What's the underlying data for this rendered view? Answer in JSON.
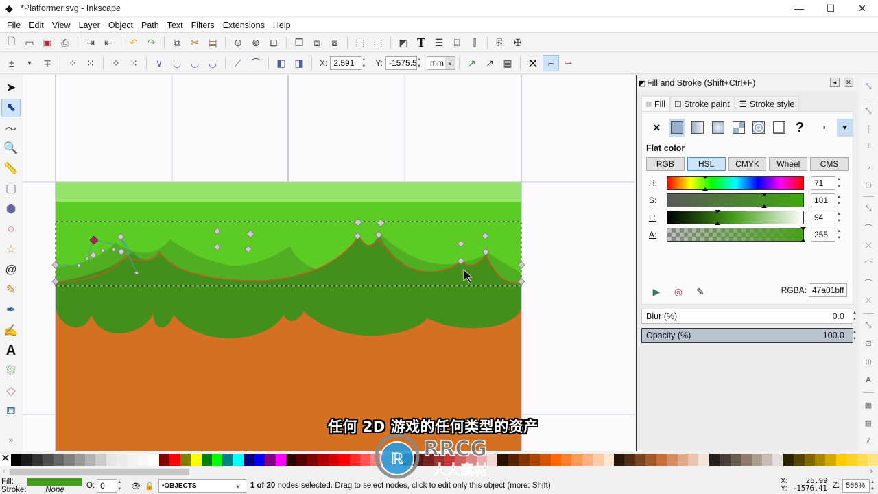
{
  "window": {
    "title": "*Platformer.svg - Inkscape",
    "controls": [
      "minimize",
      "maximize",
      "close"
    ]
  },
  "menu": [
    "File",
    "Edit",
    "View",
    "Layer",
    "Object",
    "Path",
    "Text",
    "Filters",
    "Extensions",
    "Help"
  ],
  "commands_bar": {
    "icons": [
      "new-document-icon",
      "open-icon",
      "save-icon",
      "print-icon",
      "import-icon",
      "export-icon",
      "undo-icon",
      "redo-icon",
      "copy-icon",
      "cut-icon",
      "paste-icon",
      "zoom-selection-icon",
      "zoom-drawing-icon",
      "zoom-page-icon",
      "duplicate-icon",
      "clone-icon",
      "unlink-clone-icon",
      "group-icon",
      "ungroup-icon",
      "fill-stroke-icon",
      "text-font-icon",
      "layers-icon",
      "xml-editor-icon",
      "align-icon",
      "document-properties-icon",
      "preferences-icon"
    ]
  },
  "node_toolbar": {
    "x_label": "X:",
    "x_value": "2.591",
    "y_label": "Y:",
    "y_value": "-1575.5",
    "unit": "mm"
  },
  "tools": [
    "selector",
    "node",
    "tweak",
    "zoom",
    "measure",
    "rectangle",
    "3d-box",
    "ellipse",
    "star",
    "spiral",
    "pencil",
    "pen",
    "calligraphy",
    "text",
    "spray",
    "eraser",
    "paint-bucket"
  ],
  "active_tool": "node",
  "canvas": {
    "colors": {
      "sky_light": "#96e36c",
      "grass_top": "#5ccb24",
      "grass_mid": "#4fae22",
      "grass_dark": "#438f1c",
      "dirt": "#d47021"
    }
  },
  "fill_stroke": {
    "title": "Fill and Stroke (Shift+Ctrl+F)",
    "tabs": [
      "Fill",
      "Stroke paint",
      "Stroke style"
    ],
    "active_tab": "Fill",
    "paint_type": "Flat color",
    "color_modes": [
      "RGB",
      "HSL",
      "CMYK",
      "Wheel",
      "CMS"
    ],
    "active_mode": "HSL",
    "sliders": [
      {
        "label": "H:",
        "value": "71",
        "fraction": 0.28
      },
      {
        "label": "S:",
        "value": "181",
        "fraction": 0.71
      },
      {
        "label": "L:",
        "value": "94",
        "fraction": 0.37
      },
      {
        "label": "A:",
        "value": "255",
        "fraction": 1.0
      }
    ],
    "rgba_label": "RGBA:",
    "rgba_value": "47a01bff",
    "blur_label": "Blur (%)",
    "blur_value": "0.0",
    "opacity_label": "Opacity (%)",
    "opacity_value": "100.0"
  },
  "palette": [
    "#000000",
    "#1a1a1a",
    "#333333",
    "#4d4d4d",
    "#666666",
    "#808080",
    "#999999",
    "#b3b3b3",
    "#cccccc",
    "#e6e6e6",
    "#ececec",
    "#f2f2f2",
    "#f8f8f8",
    "#ffffff",
    "#800000",
    "#ff0000",
    "#808000",
    "#ffff00",
    "#008000",
    "#00ff00",
    "#008080",
    "#00ffff",
    "#000080",
    "#0000ff",
    "#800080",
    "#ff00ff",
    "#2b0000",
    "#550000",
    "#800000",
    "#aa0000",
    "#d40000",
    "#ff0000",
    "#ff2a2a",
    "#ff5555",
    "#ff8080",
    "#ffaaaa",
    "#ffd5d5",
    "#280b0b",
    "#501616",
    "#782121",
    "#a02c2c",
    "#c83737",
    "#d35f5f",
    "#de8787",
    "#e9afaf",
    "#f4d7d7",
    "#2b1100",
    "#552200",
    "#803300",
    "#aa4400",
    "#d45500",
    "#ff6600",
    "#ff7f2a",
    "#ff9955",
    "#ffb380",
    "#ffccaa",
    "#ffe6d5",
    "#28170b",
    "#502d16",
    "#784421",
    "#a05a2c",
    "#c87137",
    "#d38d5f",
    "#deaa87",
    "#e9c6af",
    "#f4e3d7",
    "#241f1c",
    "#483e37",
    "#6c5d53",
    "#917c6f",
    "#ac9d93",
    "#c8beb7",
    "#e3dedb",
    "#2b2200",
    "#554400",
    "#806600",
    "#aa8800",
    "#d4aa00",
    "#ffcc00",
    "#ffd42a",
    "#ffdd55",
    "#ffe680"
  ],
  "status": {
    "fill_label": "Fill:",
    "stroke_label": "Stroke:",
    "fill_color": "#47a01b",
    "stroke_value": "None",
    "opacity_label": "O:",
    "opacity_value": "0",
    "layer": "•OBJECTS",
    "message_bold": "1 of 20",
    "message": " nodes selected. Drag to select nodes, click to edit only this object (more: Shift)",
    "cursor_x_label": "X:",
    "cursor_x": "26.99",
    "cursor_y_label": "Y:",
    "cursor_y": "-1576.41",
    "zoom_label": "Z:",
    "zoom": "566%"
  },
  "overlay": {
    "subtitle": "任何 2D 游戏的任何类型的资产",
    "watermark": "RRCG 人人素材"
  }
}
